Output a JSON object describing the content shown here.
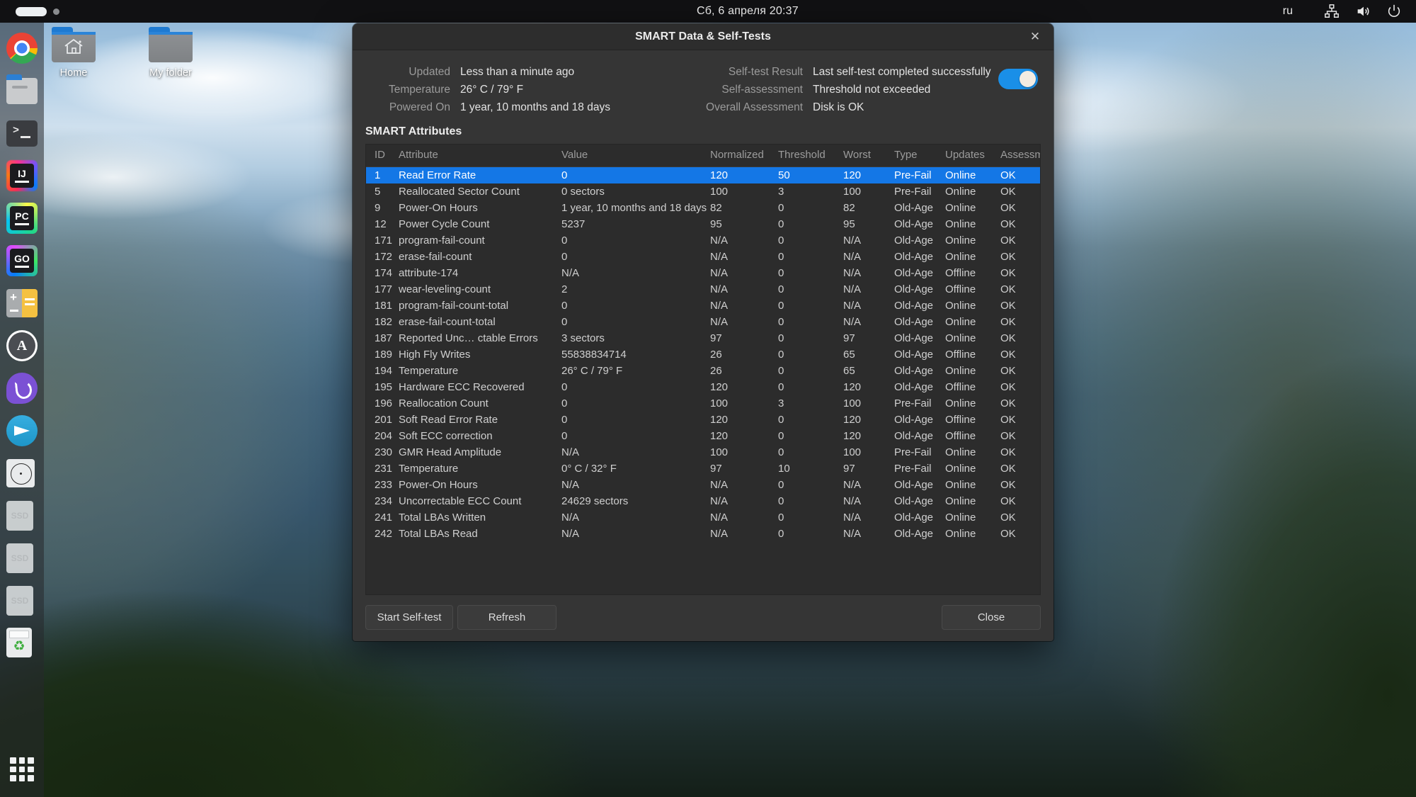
{
  "panel": {
    "clock": "Сб, 6 апреля  20:37",
    "keyboard_layout": "ru",
    "tray": [
      {
        "name": "network-icon"
      },
      {
        "name": "volume-icon"
      },
      {
        "name": "power-icon"
      }
    ]
  },
  "dock": {
    "items": [
      {
        "name": "chrome",
        "icon": "chrome-icon"
      },
      {
        "name": "files",
        "icon": "file-manager-icon"
      },
      {
        "name": "terminal",
        "icon": "terminal-icon"
      },
      {
        "name": "intellij-idea",
        "icon": "intellij-idea-icon",
        "label": "IJ"
      },
      {
        "name": "pycharm",
        "icon": "pycharm-icon",
        "label": "PC"
      },
      {
        "name": "goland",
        "icon": "goland-icon",
        "label": "GO"
      },
      {
        "name": "calculator",
        "icon": "calculator-icon"
      },
      {
        "name": "app-store",
        "icon": "app-store-icon"
      },
      {
        "name": "viber",
        "icon": "viber-icon"
      },
      {
        "name": "telegram",
        "icon": "telegram-icon"
      },
      {
        "name": "disk-utility",
        "icon": "disk-icon"
      },
      {
        "name": "ssd-1",
        "icon": "ssd-icon",
        "label": "SSD"
      },
      {
        "name": "ssd-2",
        "icon": "ssd-icon",
        "label": "SSD"
      },
      {
        "name": "ssd-3",
        "icon": "ssd-icon",
        "label": "SSD"
      },
      {
        "name": "trash",
        "icon": "trash-icon"
      },
      {
        "name": "app-grid",
        "icon": "grid-icon"
      }
    ]
  },
  "desktop": {
    "icons": [
      {
        "label": "Home",
        "icon": "home-folder-icon"
      },
      {
        "label": "My folder",
        "icon": "folder-icon"
      }
    ]
  },
  "dialog": {
    "title": "SMART Data & Self-Tests",
    "close_icon": "✕",
    "summary_left": [
      {
        "key": "Updated",
        "value": "Less than a minute ago"
      },
      {
        "key": "Temperature",
        "value": "26° C / 79° F"
      },
      {
        "key": "Powered On",
        "value": "1 year, 10 months and 18 days"
      }
    ],
    "summary_right": [
      {
        "key": "Self-test Result",
        "value": "Last self-test completed successfully"
      },
      {
        "key": "Self-assessment",
        "value": "Threshold not exceeded"
      },
      {
        "key": "Overall Assessment",
        "value": "Disk is OK"
      }
    ],
    "smart_toggle": {
      "name": "smart-enabled-toggle",
      "state": "on",
      "color": "#1a8fe8"
    },
    "section_title": "SMART Attributes",
    "table": {
      "headers": [
        "ID",
        "Attribute",
        "Value",
        "Normalized",
        "Threshold",
        "Worst",
        "Type",
        "Updates",
        "Assessment"
      ],
      "selected_row_index": 0,
      "selected_color": "#1477e6",
      "rows": [
        [
          "1",
          "Read Error Rate",
          "0",
          "120",
          "50",
          "120",
          "Pre-Fail",
          "Online",
          "OK"
        ],
        [
          "5",
          "Reallocated Sector Count",
          "0 sectors",
          "100",
          "3",
          "100",
          "Pre-Fail",
          "Online",
          "OK"
        ],
        [
          "9",
          "Power-On Hours",
          "1 year, 10 months and 18 days",
          "82",
          "0",
          "82",
          "Old-Age",
          "Online",
          "OK"
        ],
        [
          "12",
          "Power Cycle Count",
          "5237",
          "95",
          "0",
          "95",
          "Old-Age",
          "Online",
          "OK"
        ],
        [
          "171",
          "program-fail-count",
          "0",
          "N/A",
          "0",
          "N/A",
          "Old-Age",
          "Online",
          "OK"
        ],
        [
          "172",
          "erase-fail-count",
          "0",
          "N/A",
          "0",
          "N/A",
          "Old-Age",
          "Online",
          "OK"
        ],
        [
          "174",
          "attribute-174",
          "N/A",
          "N/A",
          "0",
          "N/A",
          "Old-Age",
          "Offline",
          "OK"
        ],
        [
          "177",
          "wear-leveling-count",
          "2",
          "N/A",
          "0",
          "N/A",
          "Old-Age",
          "Offline",
          "OK"
        ],
        [
          "181",
          "program-fail-count-total",
          "0",
          "N/A",
          "0",
          "N/A",
          "Old-Age",
          "Online",
          "OK"
        ],
        [
          "182",
          "erase-fail-count-total",
          "0",
          "N/A",
          "0",
          "N/A",
          "Old-Age",
          "Online",
          "OK"
        ],
        [
          "187",
          "Reported Unc… ctable Errors",
          "3 sectors",
          "97",
          "0",
          "97",
          "Old-Age",
          "Online",
          "OK"
        ],
        [
          "189",
          "High Fly Writes",
          "55838834714",
          "26",
          "0",
          "65",
          "Old-Age",
          "Offline",
          "OK"
        ],
        [
          "194",
          "Temperature",
          "26° C / 79° F",
          "26",
          "0",
          "65",
          "Old-Age",
          "Online",
          "OK"
        ],
        [
          "195",
          "Hardware ECC Recovered",
          "0",
          "120",
          "0",
          "120",
          "Old-Age",
          "Offline",
          "OK"
        ],
        [
          "196",
          "Reallocation Count",
          "0",
          "100",
          "3",
          "100",
          "Pre-Fail",
          "Online",
          "OK"
        ],
        [
          "201",
          "Soft Read Error Rate",
          "0",
          "120",
          "0",
          "120",
          "Old-Age",
          "Offline",
          "OK"
        ],
        [
          "204",
          "Soft ECC correction",
          "0",
          "120",
          "0",
          "120",
          "Old-Age",
          "Offline",
          "OK"
        ],
        [
          "230",
          "GMR Head Amplitude",
          "N/A",
          "100",
          "0",
          "100",
          "Pre-Fail",
          "Online",
          "OK"
        ],
        [
          "231",
          "Temperature",
          "0° C / 32° F",
          "97",
          "10",
          "97",
          "Pre-Fail",
          "Online",
          "OK"
        ],
        [
          "233",
          "Power-On Hours",
          "N/A",
          "N/A",
          "0",
          "N/A",
          "Old-Age",
          "Online",
          "OK"
        ],
        [
          "234",
          "Uncorrectable ECC Count",
          "24629 sectors",
          "N/A",
          "0",
          "N/A",
          "Old-Age",
          "Online",
          "OK"
        ],
        [
          "241",
          "Total LBAs Written",
          "N/A",
          "N/A",
          "0",
          "N/A",
          "Old-Age",
          "Online",
          "OK"
        ],
        [
          "242",
          "Total LBAs Read",
          "N/A",
          "N/A",
          "0",
          "N/A",
          "Old-Age",
          "Online",
          "OK"
        ]
      ]
    },
    "buttons": {
      "start_self_test": "Start Self-test",
      "refresh": "Refresh",
      "close": "Close"
    }
  }
}
